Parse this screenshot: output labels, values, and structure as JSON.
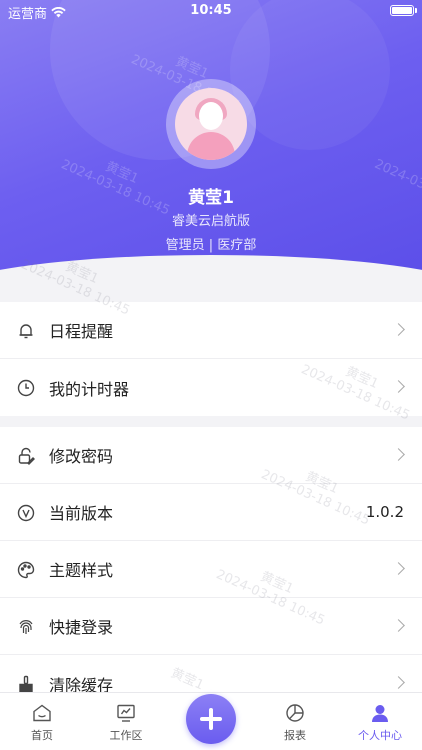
{
  "status_bar": {
    "carrier": "运营商",
    "time": "10:45"
  },
  "profile": {
    "name": "黄莹1",
    "organization": "睿美云启航版",
    "role": "管理员 | 医疗部"
  },
  "watermark": {
    "name": "黄莹1",
    "date": "2024-03-18 10:45"
  },
  "menu_group_1": [
    {
      "label": "日程提醒",
      "icon": "bell-icon"
    },
    {
      "label": "我的计时器",
      "icon": "clock-icon"
    }
  ],
  "menu_group_2": [
    {
      "label": "修改密码",
      "icon": "lock-edit-icon"
    },
    {
      "label": "当前版本",
      "icon": "version-icon",
      "value": "1.0.2"
    },
    {
      "label": "主题样式",
      "icon": "palette-icon"
    },
    {
      "label": "快捷登录",
      "icon": "fingerprint-icon"
    },
    {
      "label": "清除缓存",
      "icon": "broom-icon"
    }
  ],
  "tabbar": {
    "items": [
      {
        "label": "首页",
        "icon": "home-icon"
      },
      {
        "label": "工作区",
        "icon": "workspace-icon"
      },
      {
        "label": "报表",
        "icon": "pie-chart-icon"
      },
      {
        "label": "个人中心",
        "icon": "user-icon",
        "active": true
      }
    ],
    "add_icon": "plus-icon"
  },
  "colors": {
    "accent": "#6a5cef",
    "header_start": "#8a7ef3",
    "header_end": "#5a4de8"
  }
}
